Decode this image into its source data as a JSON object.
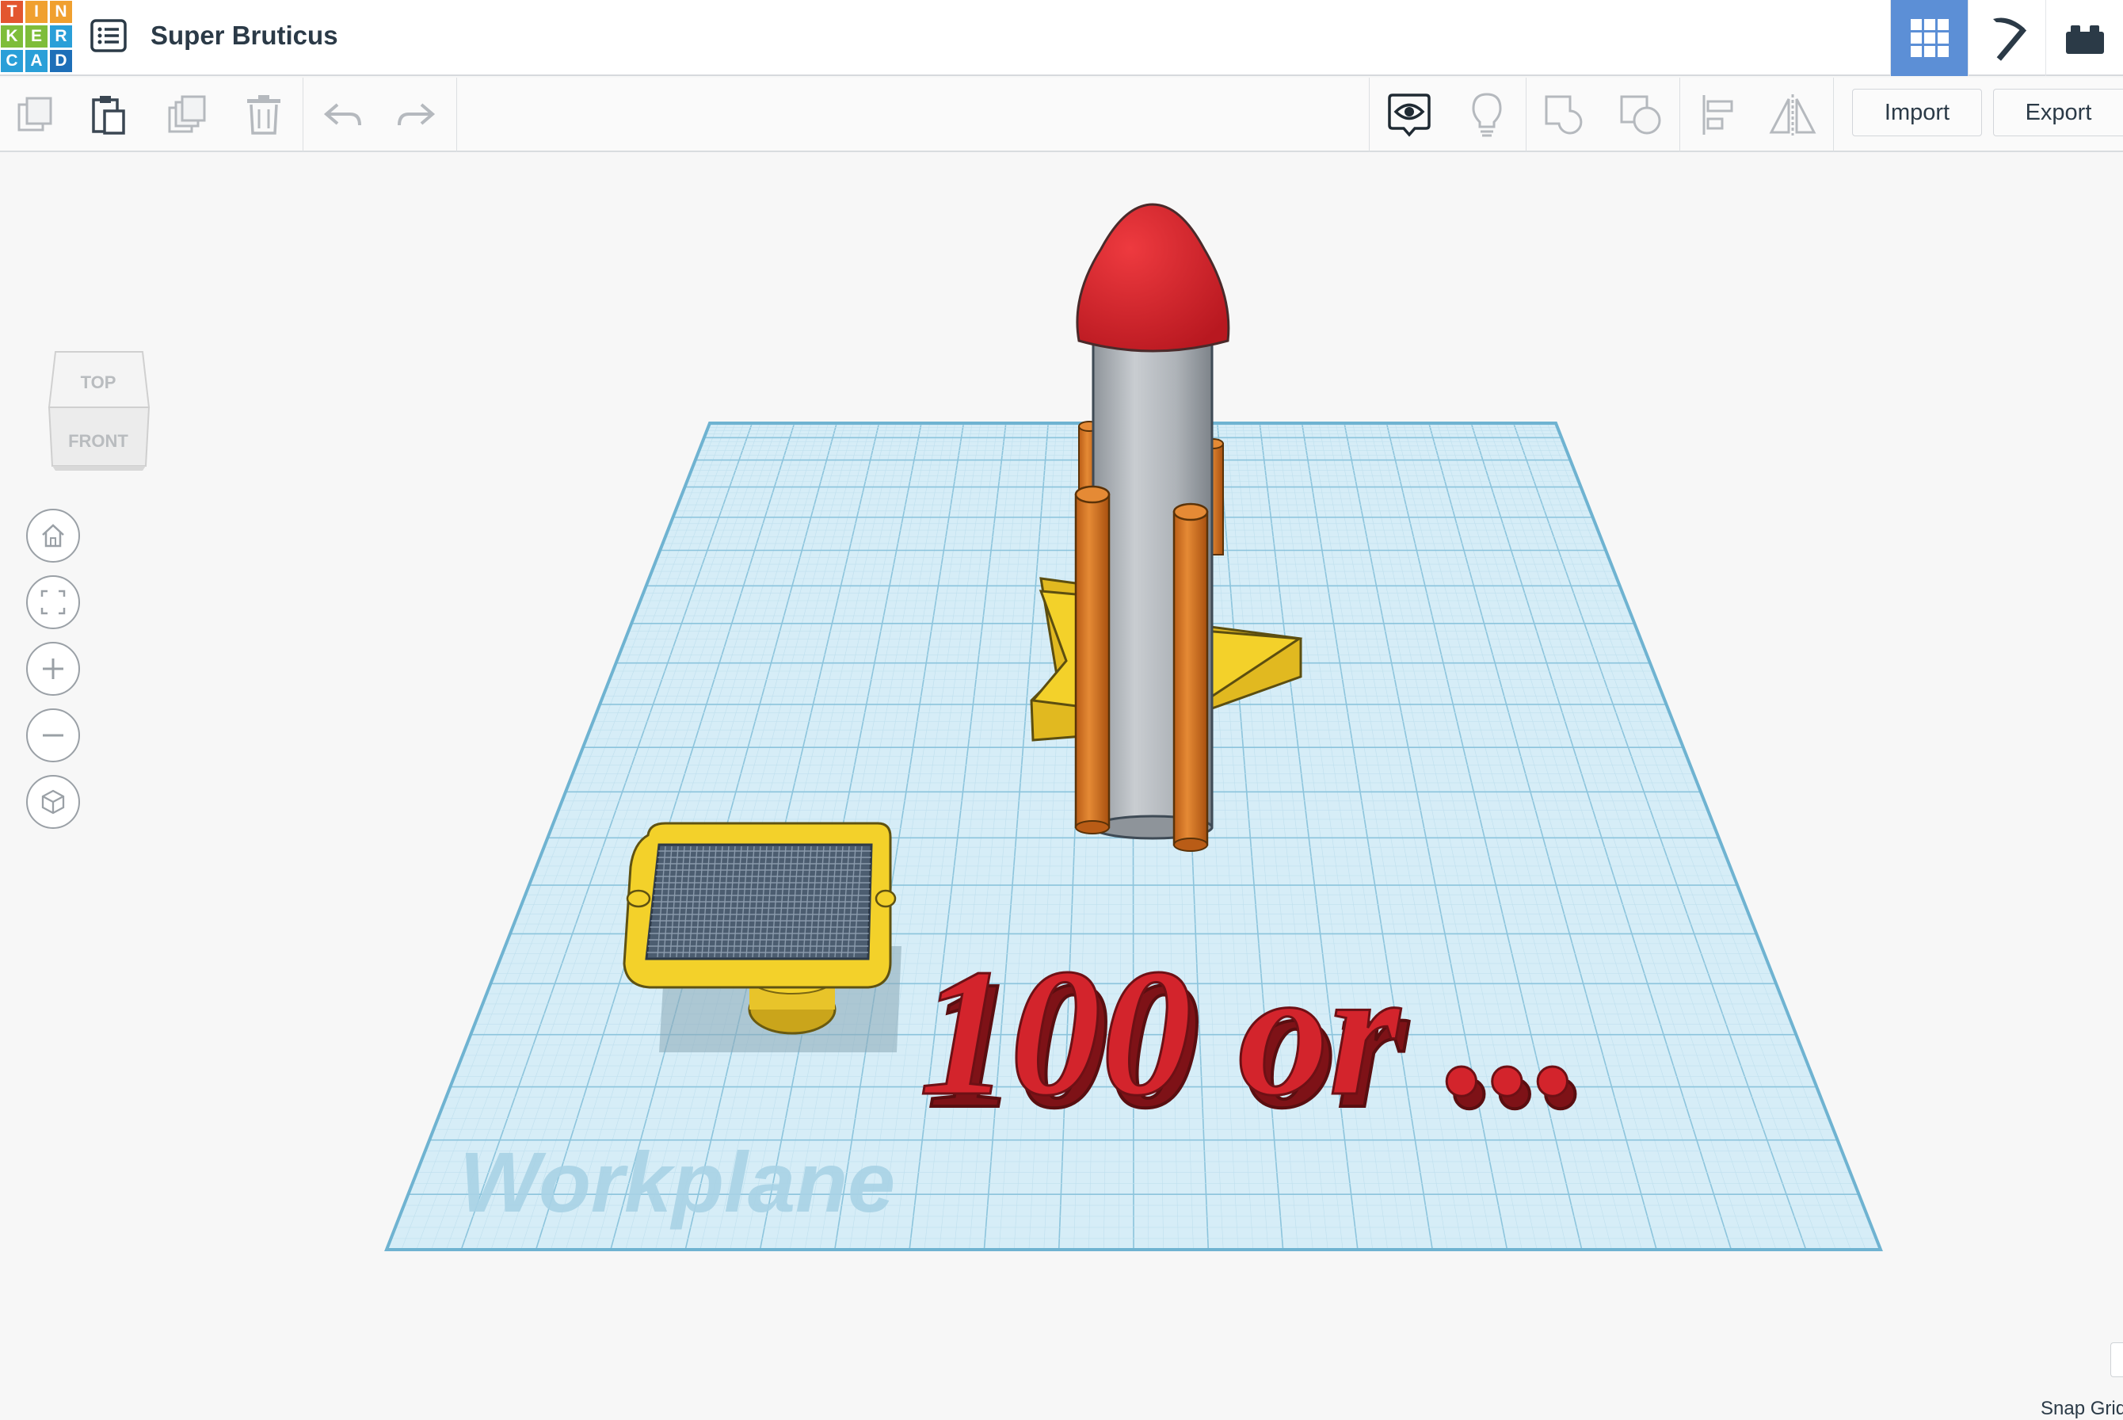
{
  "app": {
    "logo_letters": [
      "T",
      "I",
      "N",
      "K",
      "E",
      "R",
      "C",
      "A",
      "D"
    ],
    "logo_colors": [
      "#e3562f",
      "#f0a02f",
      "#f0a02f",
      "#7ebd3a",
      "#7ebd3a",
      "#2a9fd8",
      "#2a9fd8",
      "#2a9fd8",
      "#1e6fb8"
    ],
    "project_title": "Super Bruticus"
  },
  "header": {
    "views": [
      {
        "name": "3D design",
        "icon": "grid-icon",
        "active": true
      },
      {
        "name": "Blocks",
        "icon": "pickaxe-icon",
        "active": false
      },
      {
        "name": "Bricks",
        "icon": "brick-icon",
        "active": false
      }
    ]
  },
  "toolbar": {
    "left_tools": [
      "copy-icon",
      "paste-icon",
      "duplicate-icon",
      "delete-icon",
      "undo-icon",
      "redo-icon"
    ],
    "right_tools": [
      "show-all-icon",
      "notes-icon",
      "group-icon",
      "ungroup-icon",
      "align-icon",
      "mirror-icon"
    ],
    "import_label": "Import",
    "export_label": "Export"
  },
  "viewcube": {
    "top_label": "TOP",
    "front_label": "FRONT"
  },
  "nav": [
    "home-icon",
    "fit-view-icon",
    "zoom-in-icon",
    "zoom-out-icon",
    "perspective-icon"
  ],
  "scene": {
    "workplane_label": "Workplane",
    "text_object": "100 or ...",
    "objects": [
      "rocket",
      "star-base",
      "solar-panel",
      "text-100-or"
    ]
  },
  "status": {
    "snap_grid_label": "Snap Grid"
  },
  "colors": {
    "accent": "#5c8fd6",
    "workplane": "#cfe8f3",
    "grid": "#9fd0e4",
    "red": "#d3242c",
    "yellow": "#f3d12a",
    "orange": "#d8701f",
    "gray": "#a9aeb4"
  }
}
